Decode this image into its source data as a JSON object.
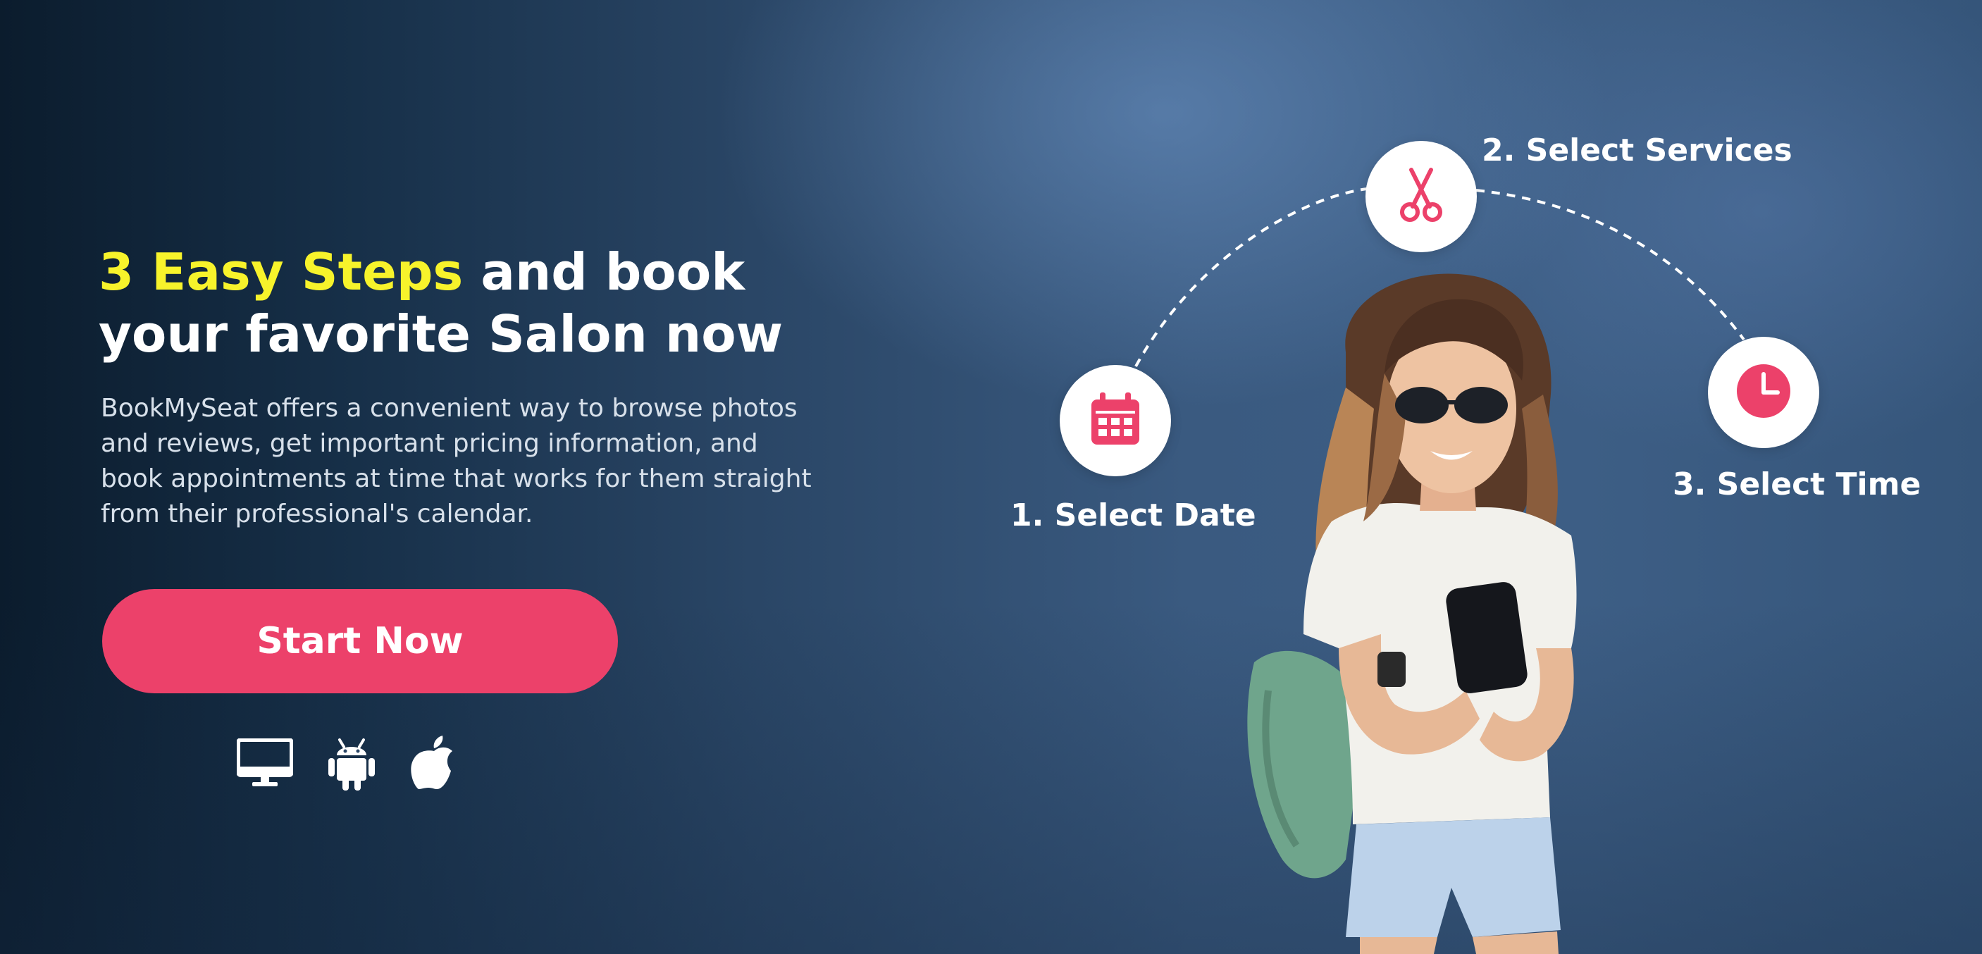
{
  "hero": {
    "headline_accent": "3 Easy Steps",
    "headline_rest_line1": " and book",
    "headline_line2": "your favorite Salon now",
    "description": "BookMySeat offers a convenient way to browse photos and reviews, get important pricing information, and book appointments at time that works for them straight from their professional's calendar.",
    "cta_label": "Start Now",
    "platforms": [
      "desktop-icon",
      "android-icon",
      "apple-icon"
    ]
  },
  "steps": [
    {
      "label": "1. Select Date",
      "icon": "calendar-icon"
    },
    {
      "label": "2. Select Services",
      "icon": "scissors-icon"
    },
    {
      "label": "3. Select Time",
      "icon": "clock-icon"
    }
  ],
  "colors": {
    "accent_yellow": "#f7f32b",
    "brand_pink": "#ec416a",
    "text_white": "#ffffff",
    "background_navy": "#2a4666"
  }
}
